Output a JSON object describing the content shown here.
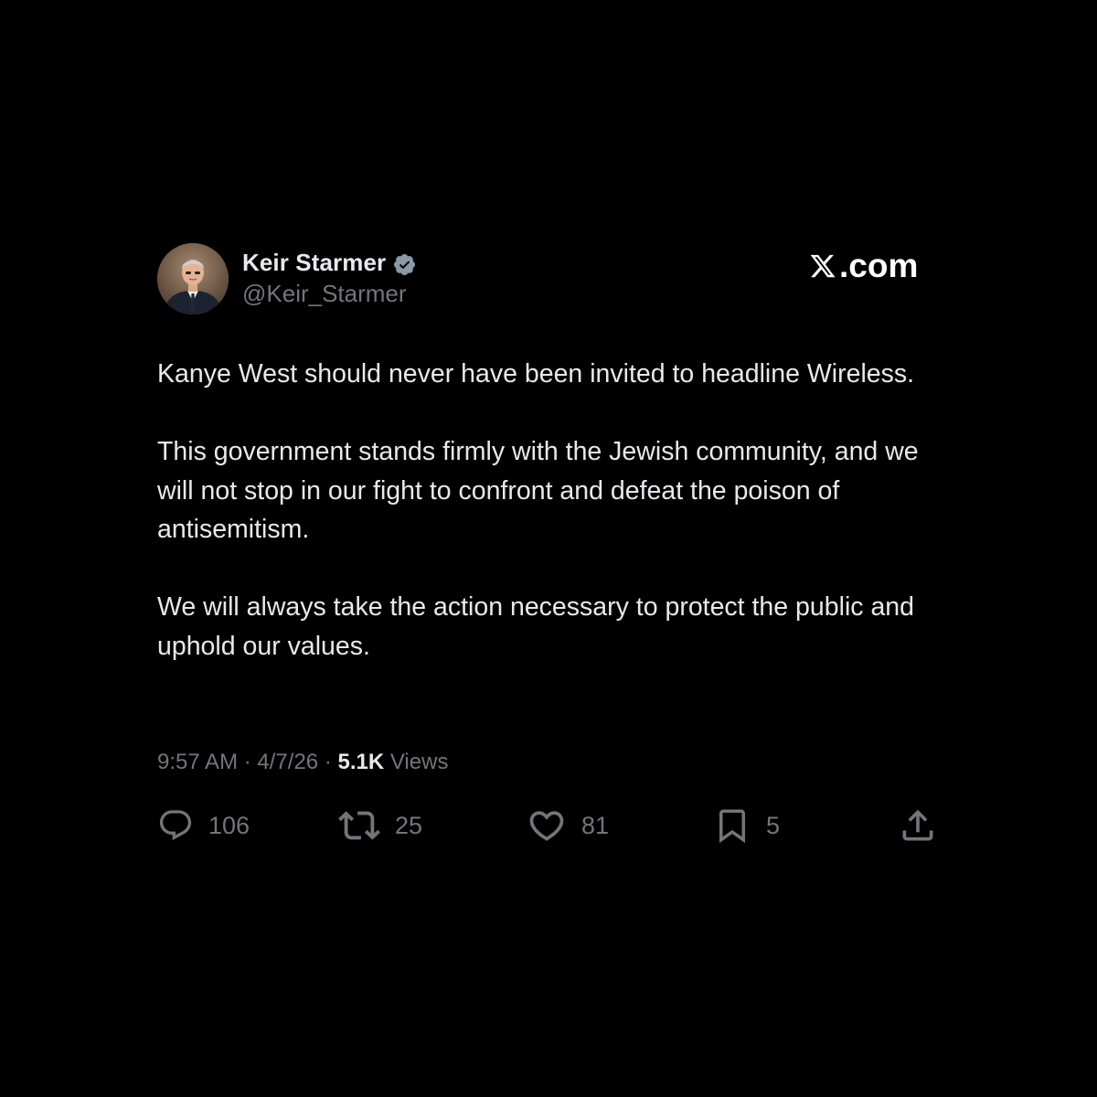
{
  "author": {
    "name": "Keir Starmer",
    "handle": "@Keir_Starmer",
    "verified_color": "#8b98a5"
  },
  "brand": {
    "suffix": ".com"
  },
  "tweet": {
    "paragraphs": [
      "Kanye West should never have been invited to headline Wireless.",
      "This government stands firmly with the Jewish community, and we will not stop in our fight to confront and defeat the poison of antisemitism.",
      "We will always take the action necessary to protect the public and uphold our values."
    ],
    "time": "9:57 AM",
    "date": "4/7/26",
    "separator": "·",
    "views_count": "5.1K",
    "views_label": "Views"
  },
  "actions": {
    "replies": "106",
    "reposts": "25",
    "likes": "81",
    "bookmarks": "5"
  },
  "colors": {
    "background": "#000000",
    "text_primary": "#e7e9ea",
    "text_secondary": "#71767b"
  }
}
